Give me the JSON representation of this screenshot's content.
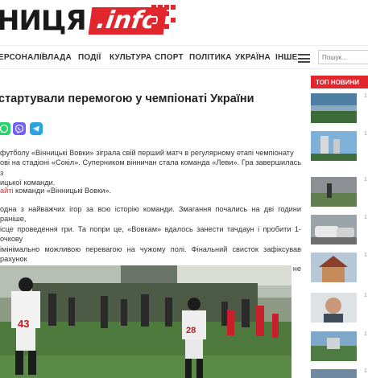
{
  "header": {
    "logo_text": "НИЦЯ",
    "logo_domain": ".info"
  },
  "nav": {
    "items": [
      {
        "label": "ЕРСОНАЛІЇ",
        "name": "nav-item-personalii"
      },
      {
        "label": "ВЛАДА",
        "name": "nav-item-vlada"
      },
      {
        "label": "ПОДІЇ",
        "name": "nav-item-podii"
      },
      {
        "label": "КУЛЬТУРА",
        "name": "nav-item-kultura"
      },
      {
        "label": "СПОРТ",
        "name": "nav-item-sport"
      },
      {
        "label": "ПОЛІТИКА",
        "name": "nav-item-polityka"
      },
      {
        "label": "УКРАЇНА",
        "name": "nav-item-ukraina"
      },
      {
        "label": "ІНШЕ",
        "name": "nav-item-inshe"
      }
    ],
    "search_placeholder": "Пошук..."
  },
  "article": {
    "title": "стартували перемогою у чемпіонаті України",
    "p1": "футболу «Вінницькі Вовки» зіграла свій перший матч в регулярному етапі чемпіонату\nові на стадіоні «Сокіл». Суперником вінничан стала команда «Леви». Гра завершилась з\nицької команди.",
    "p2_link": "айті",
    "p2_text": " команди «Вінницькі Вовки».",
    "p3": "одна з найважчих ігор за всю історію команди. Змагання почались на дві години раніше,\nісце проведення гри. Та попри це, «Вовкам» вдалось занести тачдаун і пробити 1-очкову\nімінімально можливою перевагою на чужому полі. Фінальний свисток зафіксував рахунок\nичному ситуація була незрозумілою до самого фіналу, адже «Леви» ледь не реалізували\nби їм перемогу."
  },
  "sidebar": {
    "header": "ТОП НОВИНИ",
    "news": [
      {
        "date": "1"
      },
      {
        "date": "1"
      },
      {
        "date": "1"
      },
      {
        "date": "1"
      },
      {
        "date": "1"
      },
      {
        "date": "1"
      },
      {
        "date": "1"
      },
      {
        "date": "1"
      }
    ]
  },
  "colors": {
    "brand_red": "#e1262d",
    "whatsapp": "#25d366",
    "viber": "#7360f2",
    "telegram": "#2aa3de"
  }
}
